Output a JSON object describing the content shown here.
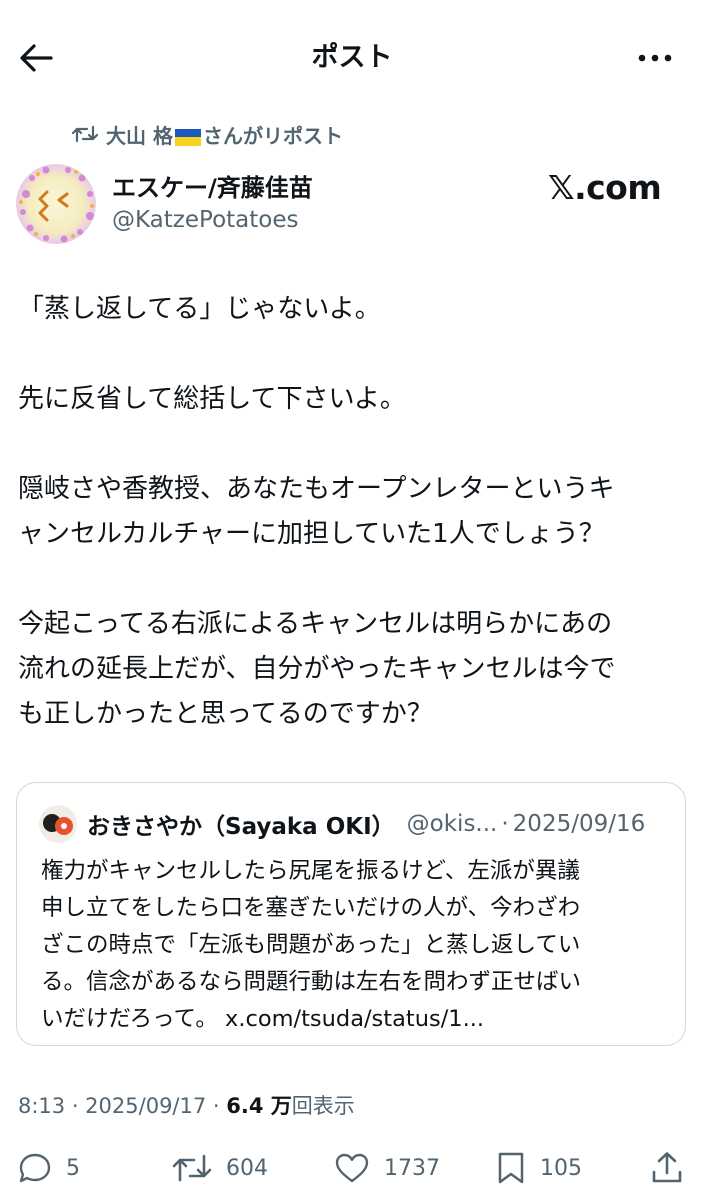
{
  "header": {
    "title": "ポスト"
  },
  "repost": {
    "user": "大山 格",
    "suffix": "さんがリポスト"
  },
  "author": {
    "display_name": "エスケー/斉藤佳苗",
    "handle": "@KatzePotatoes"
  },
  "watermark": "𝕏.com",
  "post": {
    "lines": [
      "「蒸し返してる」じゃないよ。",
      "先に反省して総括して下さいよ。",
      "隠岐さや香教授、あなたもオープンレターというキ",
      "ャンセルカルチャーに加担していた1人でしょう？",
      "今起こってる右派によるキャンセルは明らかにあの",
      "流れの延長上だが、自分がやったキャンセルは今で",
      "も正しかったと思ってるのですか？"
    ]
  },
  "quote": {
    "name": "おきさやか（Sayaka OKI）",
    "handle": "@okis...",
    "separator": "·",
    "date": "2025/09/16",
    "lines": [
      "権力がキャンセルしたら尻尾を振るけど、左派が異議",
      "申し立てをしたら口を塞ぎたいだけの人が、今わざわ",
      "ざこの時点で「左派も問題があった」と蒸し返してい",
      "る。信念があるなら問題行動は左右を問わず正せばい",
      "いだけだろって。 x.com/tsuda/status/1..."
    ]
  },
  "meta": {
    "time": "8:13 · 2025/09/17 · ",
    "views": "6.4 万",
    "views_label": "回表示"
  },
  "actions": {
    "replies": "5",
    "reposts": "604",
    "likes": "1737",
    "bookmarks": "105"
  },
  "colors": {
    "text": "#0f1419",
    "secondary": "#536471",
    "border": "#cfd9de"
  }
}
